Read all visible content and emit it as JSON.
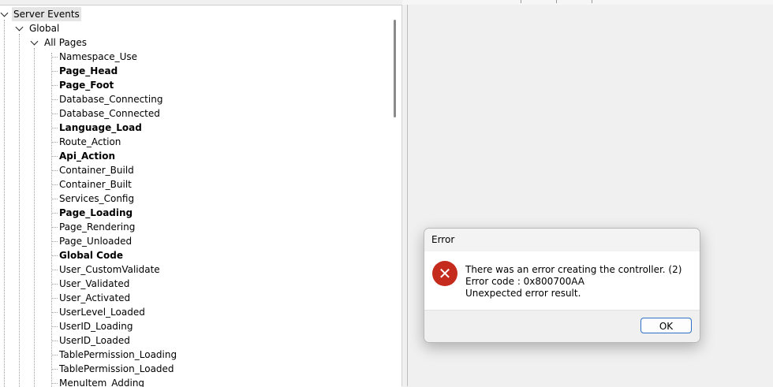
{
  "tree": {
    "root": {
      "label": "Server Events"
    },
    "global": {
      "label": "Global"
    },
    "all_pages": {
      "label": "All Pages"
    },
    "items": [
      {
        "label": "Namespace_Use",
        "bold": false
      },
      {
        "label": "Page_Head",
        "bold": true
      },
      {
        "label": "Page_Foot",
        "bold": true
      },
      {
        "label": "Database_Connecting",
        "bold": false
      },
      {
        "label": "Database_Connected",
        "bold": false
      },
      {
        "label": "Language_Load",
        "bold": true
      },
      {
        "label": "Route_Action",
        "bold": false
      },
      {
        "label": "Api_Action",
        "bold": true
      },
      {
        "label": "Container_Build",
        "bold": false
      },
      {
        "label": "Container_Built",
        "bold": false
      },
      {
        "label": "Services_Config",
        "bold": false
      },
      {
        "label": "Page_Loading",
        "bold": true
      },
      {
        "label": "Page_Rendering",
        "bold": false
      },
      {
        "label": "Page_Unloaded",
        "bold": false
      },
      {
        "label": "Global Code",
        "bold": true
      },
      {
        "label": "User_CustomValidate",
        "bold": false
      },
      {
        "label": "User_Validated",
        "bold": false
      },
      {
        "label": "User_Activated",
        "bold": false
      },
      {
        "label": "UserLevel_Loaded",
        "bold": false
      },
      {
        "label": "UserID_Loading",
        "bold": false
      },
      {
        "label": "UserID_Loaded",
        "bold": false
      },
      {
        "label": "TablePermission_Loading",
        "bold": false
      },
      {
        "label": "TablePermission_Loaded",
        "bold": false
      },
      {
        "label": "MenuItem_Adding",
        "bold": false
      }
    ]
  },
  "dialog": {
    "title": "Error",
    "icon": "error-x-icon",
    "message_line1": "There was an error creating the controller. (2)",
    "message_line2": "Error code : 0x800700AA",
    "message_line3": "Unexpected error result.",
    "ok_label": "OK"
  },
  "colors": {
    "error_icon": "#c42b1c",
    "ok_button_border": "#2d6fc5"
  }
}
